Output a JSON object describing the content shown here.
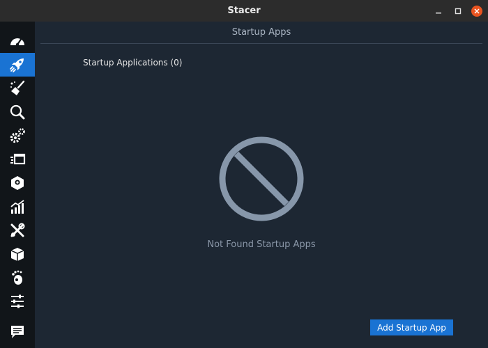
{
  "window": {
    "title": "Stacer"
  },
  "sidebar": {
    "items": [
      {
        "name": "dashboard",
        "icon": "speedometer-icon"
      },
      {
        "name": "startup-apps",
        "icon": "rocket-icon",
        "active": true
      },
      {
        "name": "system-cleaner",
        "icon": "broom-icon"
      },
      {
        "name": "search",
        "icon": "magnifier-icon"
      },
      {
        "name": "services",
        "icon": "gears-icon"
      },
      {
        "name": "processes",
        "icon": "process-icon"
      },
      {
        "name": "uninstaller",
        "icon": "package-icon"
      },
      {
        "name": "resources",
        "icon": "chart-icon"
      },
      {
        "name": "helpers",
        "icon": "tools-icon"
      },
      {
        "name": "apt-repository",
        "icon": "box-icon"
      },
      {
        "name": "gnome-settings",
        "icon": "gnome-foot-icon"
      },
      {
        "name": "settings",
        "icon": "sliders-icon"
      },
      {
        "name": "feedback",
        "icon": "chat-icon"
      }
    ]
  },
  "main": {
    "title": "Startup Apps",
    "count_label": "Startup Applications (0)",
    "empty_text": "Not Found Startup Apps",
    "add_button": "Add Startup App"
  },
  "colors": {
    "accent": "#1a73d3",
    "background": "#1d2733",
    "sidebar": "#111519",
    "close": "#e95420"
  }
}
